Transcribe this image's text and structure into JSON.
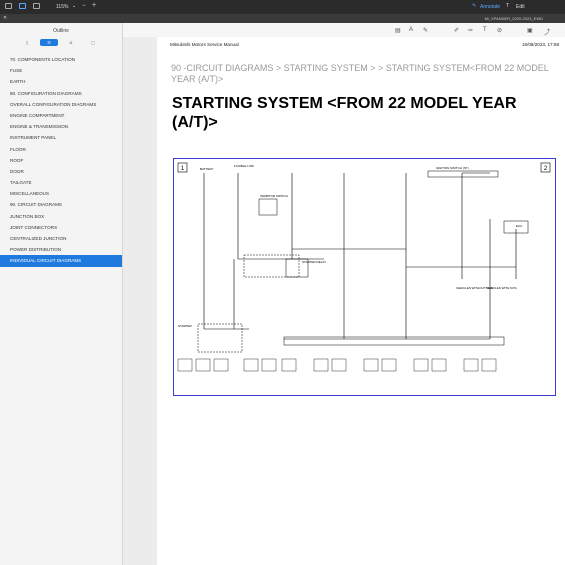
{
  "toolbar": {
    "zoom": "115%",
    "annotate_label": "Annotate",
    "edit_label": "Edit"
  },
  "document": {
    "file_name": "Mi_XPANDER_2020-2023_EWD"
  },
  "sidebar": {
    "title": "Outline",
    "items": [
      {
        "label": "70. COMPONENTS LOCATION"
      },
      {
        "label": "FUSE"
      },
      {
        "label": "EARTH"
      },
      {
        "label": "80. CONFIGURATION DIAGRAMS"
      },
      {
        "label": "OVERALL CONFIGURATION DIAGRAMS"
      },
      {
        "label": "ENGINE COMPARTMENT"
      },
      {
        "label": "ENGINE & TRANSMISSION"
      },
      {
        "label": "INSTRUMENT PANEL"
      },
      {
        "label": "FLOOR"
      },
      {
        "label": "ROOF"
      },
      {
        "label": "DOOR"
      },
      {
        "label": "TAILGATE"
      },
      {
        "label": "MISCELLANEOUS"
      },
      {
        "label": "90. CIRCUIT DIAGRAMS"
      },
      {
        "label": "JUNCTION BOX"
      },
      {
        "label": "JOINT CONNECTORS"
      },
      {
        "label": "CENTRALIZED JUNCTION"
      },
      {
        "label": "POWER DISTRIBUTION"
      },
      {
        "label": "INDIVIDUAL CIRCUIT DIAGRAMS"
      }
    ]
  },
  "page": {
    "header_left": "Mitsubishi Motors Service Manual",
    "header_right": "16/08/2023, 17:58",
    "breadcrumb": "90 -CIRCUIT DIAGRAMS > STARTING SYSTEM > > STARTING SYSTEM<FROM 22 MODEL YEAR (A/T)>",
    "title": "STARTING SYSTEM <FROM 22 MODEL YEAR (A/T)>"
  },
  "diagram": {
    "page_left": "1",
    "page_right": "2",
    "labels": {
      "battery": "BATTERY",
      "fusible_link": "FUSIBLE LINK",
      "ignition_switch": "IGNITION SWITCH (ST)",
      "starter": "STARTER",
      "starter_relay": "STARTER RELAY",
      "inhibitor_switch": "INHIBITOR SWITCH",
      "ecu": "ECU",
      "vehicles_without_kos": "VEHICLES WITHOUT KOS",
      "vehicles_with_kos": "VEHICLES WITH KOS"
    }
  }
}
